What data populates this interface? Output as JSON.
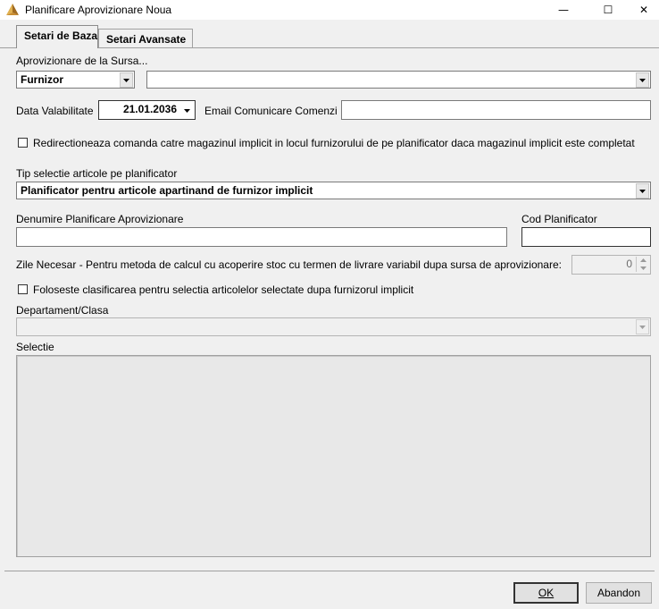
{
  "window": {
    "title": "Planificare Aprovizionare Noua",
    "minimize_glyph": "—",
    "maximize_glyph": "☐",
    "close_glyph": "✕"
  },
  "tabs": [
    {
      "label": "Setari de Baza",
      "active": true
    },
    {
      "label": "Setari Avansate",
      "active": false
    }
  ],
  "source": {
    "label": "Aprovizionare de la Sursa...",
    "type_value": "Furnizor",
    "supplier_value": ""
  },
  "validity": {
    "label": "Data Valabilitate",
    "value": "21.01.2036"
  },
  "email": {
    "label": "Email Comunicare Comenzi",
    "value": ""
  },
  "redirect_checkbox": {
    "label": "Redirectioneaza comanda catre magazinul implicit in locul furnizorului de pe planificator daca magazinul implicit este completat",
    "checked": false
  },
  "article_selection": {
    "label": "Tip selectie articole pe planificator",
    "value": "Planificator pentru articole apartinand de furnizor implicit"
  },
  "planner_name": {
    "label": "Denumire Planificare Aprovizionare",
    "value": ""
  },
  "planner_code": {
    "label": "Cod Planificator",
    "value": ""
  },
  "days_needed": {
    "label": "Zile Necesar - Pentru metoda de calcul cu acoperire stoc cu termen de livrare variabil dupa sursa de aprovizionare:",
    "value": "0"
  },
  "classification_checkbox": {
    "label": "Foloseste clasificarea pentru selectia articolelor selectate dupa furnizorul implicit",
    "checked": false
  },
  "department": {
    "label": "Departament/Clasa",
    "value": ""
  },
  "selection": {
    "label": "Selectie"
  },
  "buttons": {
    "ok": "OK",
    "cancel": "Abandon"
  },
  "colors": {
    "window_bg": "#f0f0f0",
    "titlebar_bg": "#ffffff",
    "panel_bg": "#e8e8e8"
  }
}
